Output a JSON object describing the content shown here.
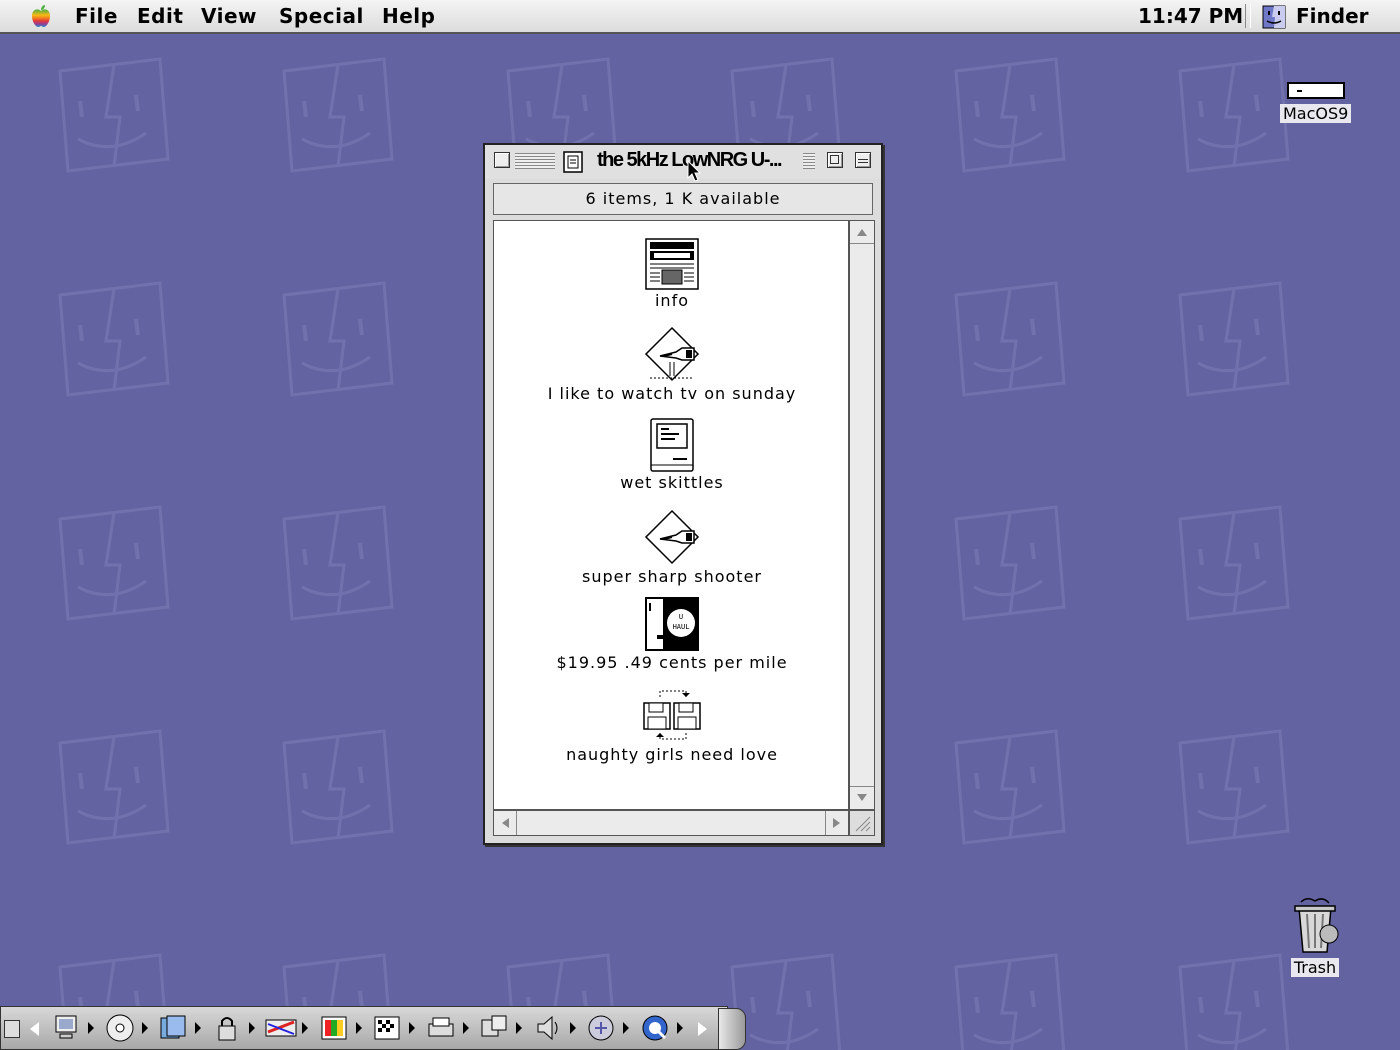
{
  "menubar": {
    "apple_icon": "apple-rainbow-icon",
    "menus": [
      "File",
      "Edit",
      "View",
      "Special",
      "Help"
    ],
    "clock": "11:47 PM",
    "active_app": "Finder",
    "active_app_icon": "finder-face-icon"
  },
  "desktop": {
    "pattern_icon": "finder-face-icon",
    "disk": {
      "label": "MacOS9",
      "icon": "hard-disk-icon"
    },
    "trash": {
      "label": "Trash",
      "icon": "trash-can-icon"
    }
  },
  "window": {
    "title": "the 5kHz LowNRG U-...",
    "info": "6 items, 1 K available",
    "items": [
      {
        "label": "info",
        "icon": "newspaper-extra-icon"
      },
      {
        "label": "I like to watch tv on sunday",
        "icon": "application-diamond-hand-icon"
      },
      {
        "label": "wet skittles",
        "icon": "classic-mac-icon"
      },
      {
        "label": "super sharp shooter",
        "icon": "application-diamond-hand-icon"
      },
      {
        "label": "$19.95  .49 cents per mile",
        "icon": "uhaul-door-icon"
      },
      {
        "label": "naughty girls need love",
        "icon": "disk-copy-icon"
      }
    ]
  },
  "control_strip": {
    "items": [
      "appletalk-icon",
      "cd-icon",
      "file-sharing-icon",
      "keychain-lock-icon",
      "location-manager-icon",
      "monitor-bit-depth-icon",
      "monitor-resolution-icon",
      "printer-icon",
      "remote-access-icon",
      "sound-volume-icon",
      "speech-icon",
      "quicktime-icon"
    ]
  },
  "colors": {
    "desktop": "#6263a0",
    "menubar": "#e8e8e8"
  }
}
